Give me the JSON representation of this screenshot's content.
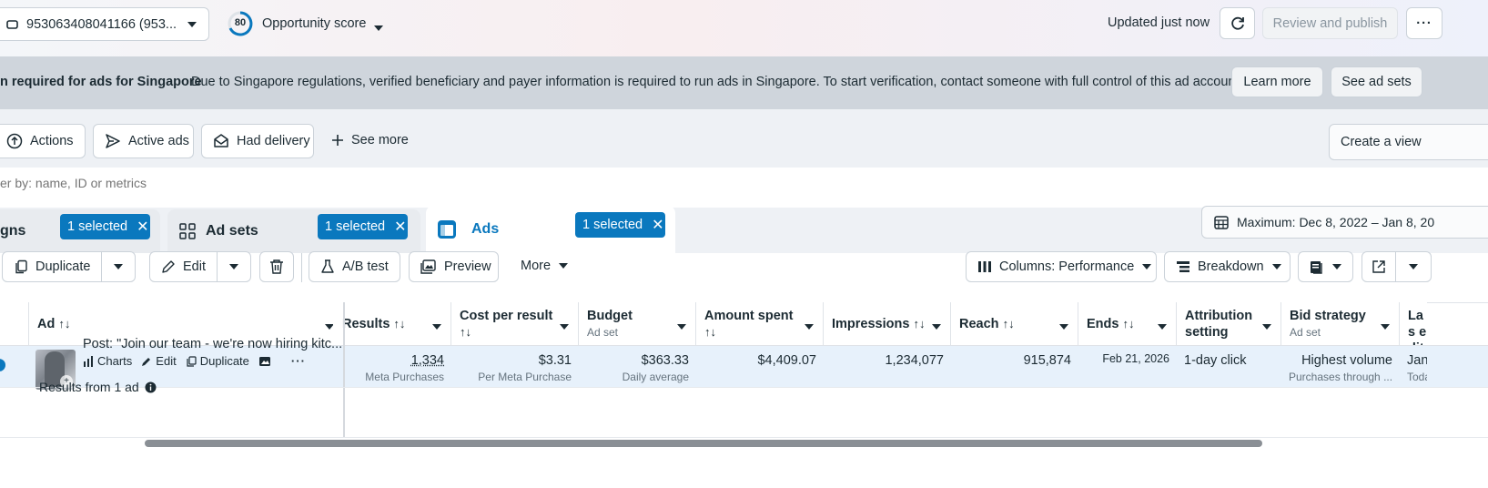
{
  "header": {
    "account_label": "953063408041166 (953...",
    "score_value": "80",
    "score_label": "Opportunity score",
    "updated_text": "Updated just now",
    "review_publish": "Review and publish"
  },
  "banner": {
    "title": "n required for ads for Singapore",
    "message": "Due to Singapore regulations, verified beneficiary and payer information is required to run ads in Singapore. To start verification, contact someone with full control of this ad account.",
    "learn_more": "Learn more",
    "see_ad_sets": "See ad sets"
  },
  "filters": {
    "actions": "Actions",
    "active_ads": "Active ads",
    "had_delivery": "Had delivery",
    "see_more": "See more",
    "create_view": "Create a view"
  },
  "search": {
    "placeholder": "er by: name, ID or metrics"
  },
  "tabs": {
    "campaigns": {
      "label": "gns",
      "pill": "1 selected"
    },
    "adsets": {
      "label": "Ad sets",
      "pill": "1 selected"
    },
    "ads": {
      "label": "Ads",
      "pill": "1 selected"
    },
    "date_range": "Maximum: Dec 8, 2022 – Jan 8, 20"
  },
  "toolbar": {
    "duplicate": "Duplicate",
    "edit": "Edit",
    "ab_test": "A/B test",
    "preview": "Preview",
    "more": "More",
    "columns": "Columns: Performance",
    "breakdown": "Breakdown"
  },
  "table": {
    "headers": {
      "ad": "Ad",
      "results": "Results",
      "cost_per_result": "Cost per result",
      "budget": "Budget",
      "budget_sub": "Ad set",
      "amount_spent": "Amount spent",
      "impressions": "Impressions",
      "reach": "Reach",
      "ends": "Ends",
      "attribution": "Attribution setting",
      "bid_strategy": "Bid strategy",
      "bid_sub": "Ad set",
      "last_edit": "Las edit"
    },
    "row": {
      "ad_name": "Post: \"Join our team - we're now hiring kitc...",
      "charts": "Charts",
      "edit": "Edit",
      "duplicate": "Duplicate",
      "results": "1,334",
      "results_sub": "Meta Purchases",
      "cost": "$3.31",
      "cost_sub": "Per Meta Purchase",
      "budget": "$363.33",
      "budget_sub": "Daily average",
      "amount": "$4,409.07",
      "impressions": "1,234,077",
      "reach": "915,874",
      "ends": "Feb 21, 2026",
      "attribution": "1-day click",
      "bid": "Highest volume",
      "bid_sub": "Purchases through ...",
      "last_edit": "Jan",
      "last_edit_sub": "Toda"
    },
    "footer": "Results from 1 ad"
  },
  "colors": {
    "accent": "#0a78be",
    "banner_bg": "#cfd5dc",
    "row_highlight": "#e7f1fb"
  }
}
